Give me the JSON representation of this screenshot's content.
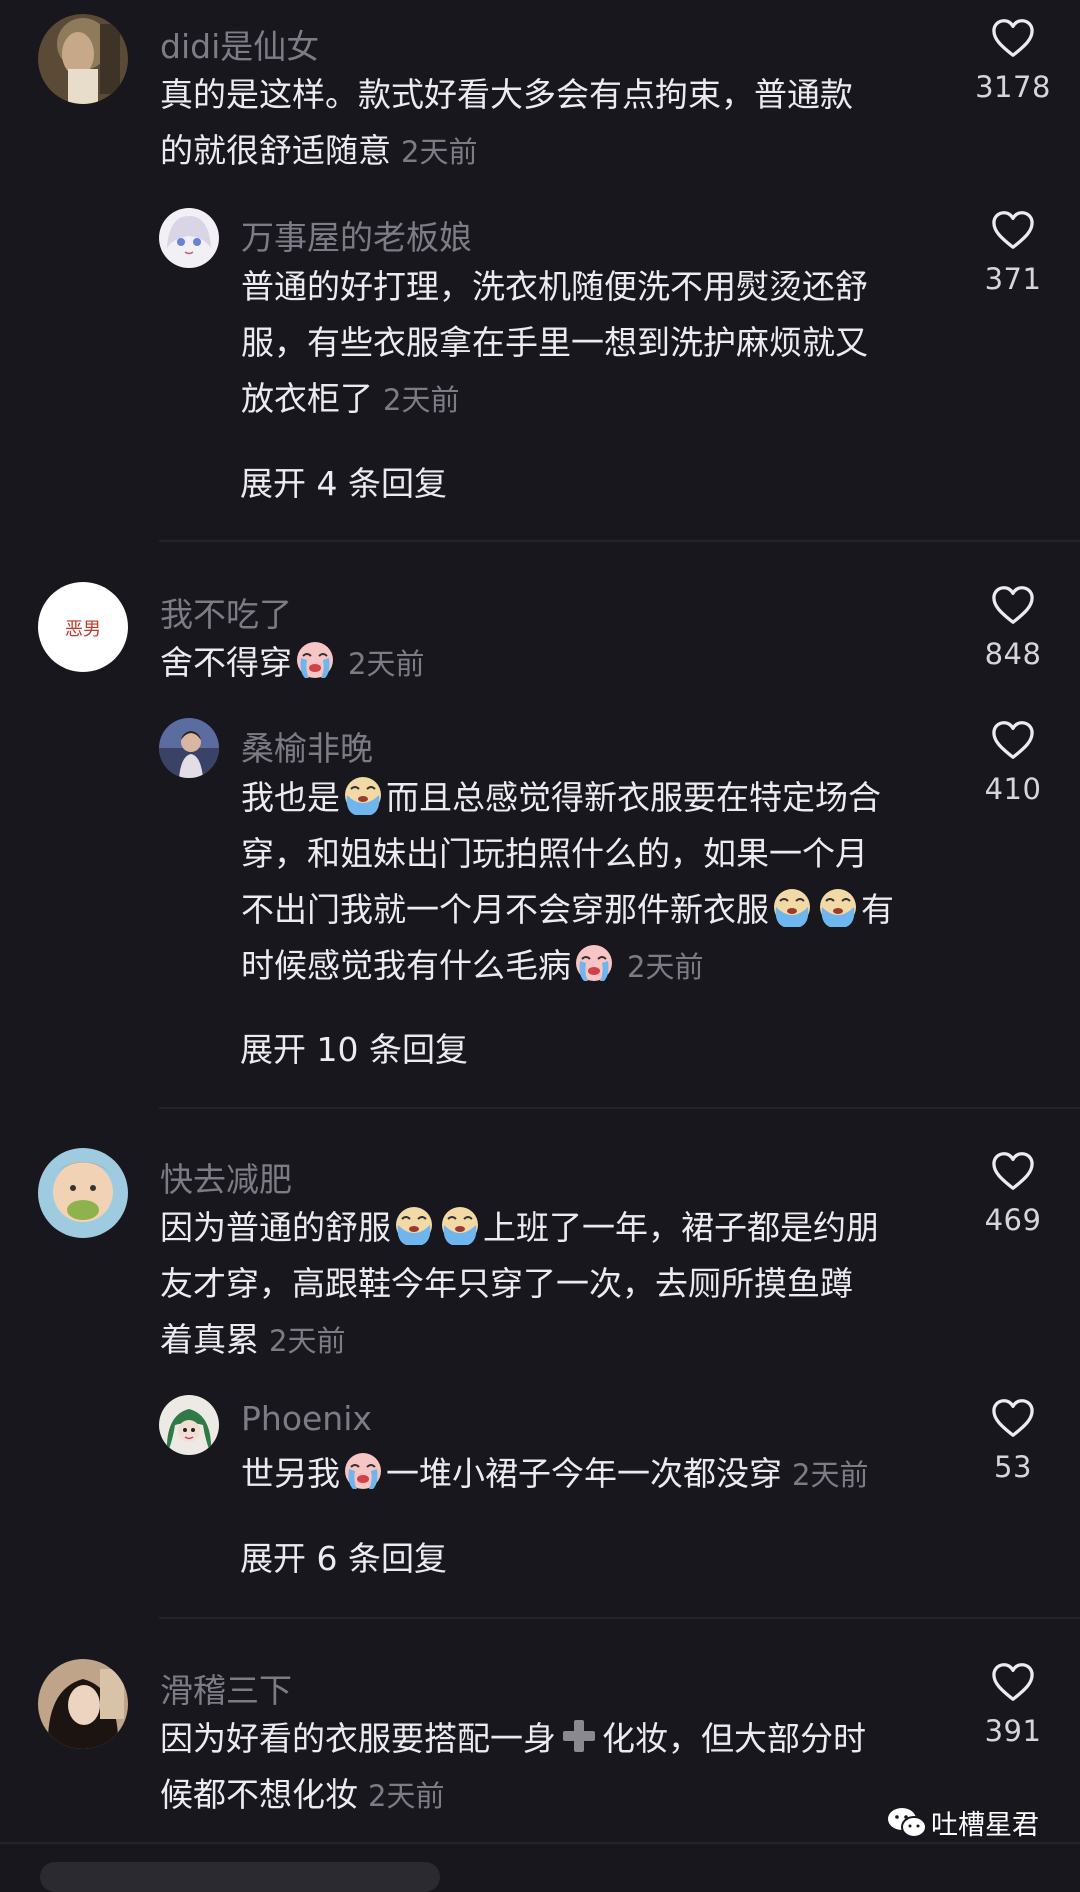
{
  "comments": [
    {
      "username": "didi是仙女",
      "lines": [
        "真的是这样。款式好看大多会有点拘束，普通款",
        "的就很舒适随意"
      ],
      "time": "2天前",
      "likes": "3178",
      "avatar": "avatar-photo-icecream"
    },
    {
      "username": "万事屋的老板娘",
      "lines": [
        "普通的好打理，洗衣机随便洗不用熨烫还舒",
        "服，有些衣服拿在手里一想到洗护麻烦就又",
        "放衣柜了"
      ],
      "time": "2天前",
      "likes": "371",
      "avatar": "avatar-anime-girl"
    },
    {
      "expand": "展开 4 条回复"
    },
    {
      "username": "我不吃了",
      "line1_before": "舍不得穿",
      "time": "2天前",
      "likes": "848",
      "avatar_text": "恶男"
    },
    {
      "username": "桑榆非晚",
      "line1_before": "我也是",
      "line1_after": "而且总感觉得新衣服要在特定场合",
      "line2": "穿，和姐妹出门玩拍照什么的，如果一个月",
      "line3_before": "不出门我就一个月不会穿那件新衣服",
      "line3_after": "有",
      "line4_before": "时候感觉我有什么毛病",
      "time": "2天前",
      "likes": "410",
      "avatar": "avatar-photo-person"
    },
    {
      "expand": "展开 10 条回复"
    },
    {
      "username": "快去减肥",
      "line1_before": "因为普通的舒服",
      "line1_after": "上班了一年，裙子都是约朋",
      "line2": "友才穿，高跟鞋今年只穿了一次，去厕所摸鱼蹲",
      "line3": "着真累",
      "time": "2天前",
      "likes": "469",
      "avatar": "avatar-baby-photo"
    },
    {
      "username": "Phoenix",
      "line1_before": "世另我",
      "line1_after": "一堆小裙子今年一次都没穿",
      "time": "2天前",
      "likes": "53",
      "avatar": "avatar-green-hair-cartoon"
    },
    {
      "expand": "展开 6 条回复"
    },
    {
      "username": "滑稽三下",
      "line1_before": "因为好看的衣服要搭配一身",
      "line1_after": "化妆，但大部分时",
      "line2": "候都不想化妆",
      "time": "2天前",
      "likes": "391",
      "avatar": "avatar-photo-woman"
    }
  ],
  "watermark": {
    "label": "吐槽星君",
    "icon": "wechat-icon"
  },
  "colors": {
    "background": "#18171d",
    "text": "#ecebf0",
    "muted": "#7d7b85"
  }
}
